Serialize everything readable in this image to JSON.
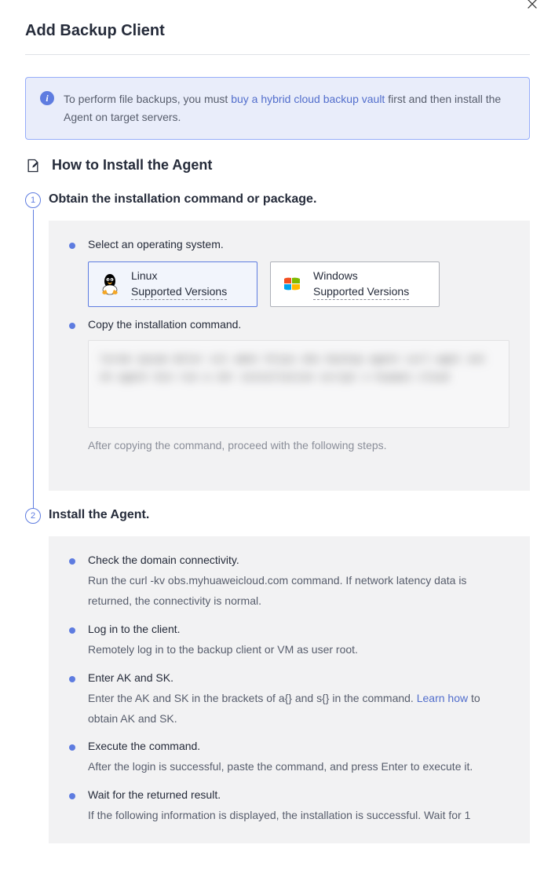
{
  "dialog": {
    "title": "Add Backup Client"
  },
  "alert": {
    "before": "To perform file backups, you must ",
    "link": "buy a hybrid cloud backup vault",
    "after": " first and then install the Agent on target servers."
  },
  "section": {
    "heading": "How to Install the Agent"
  },
  "steps": [
    {
      "num": "1",
      "title": "Obtain the installation command or package.",
      "sub1_label": "Select an operating system.",
      "os_linux_name": "Linux",
      "os_linux_sub": "Supported Versions",
      "os_windows_name": "Windows",
      "os_windows_sub": "Supported Versions",
      "sub2_label": "Copy the installation command.",
      "command_placeholder": "lorem ipsum dolor sit amet https obs backup agent curl wget set sh agent bin run a cbr installation script s huawei cloud",
      "hint": "After copying the command, proceed with the following steps."
    },
    {
      "num": "2",
      "title": "Install the Agent.",
      "bullets": [
        {
          "head": "Check the domain connectivity.",
          "desc_parts": [
            "Run the curl -kv obs.myhuaweicloud.com command. If network latency data is returned, the connectivity is normal."
          ]
        },
        {
          "head": "Log in to the client.",
          "desc_parts": [
            "Remotely log in to the backup client or VM as user root."
          ]
        },
        {
          "head": "Enter AK and SK.",
          "desc_parts": [
            "Enter the AK and SK in the brackets of a{} and s{} in the command. "
          ],
          "link": "Learn how",
          "desc_after": " to obtain AK and SK."
        },
        {
          "head": "Execute the command.",
          "desc_parts": [
            "After the login is successful, paste the command, and press Enter to execute it."
          ]
        },
        {
          "head": "Wait for the returned result.",
          "desc_parts": [
            "If the following information is displayed, the installation is successful. Wait for 1"
          ]
        }
      ]
    }
  ]
}
